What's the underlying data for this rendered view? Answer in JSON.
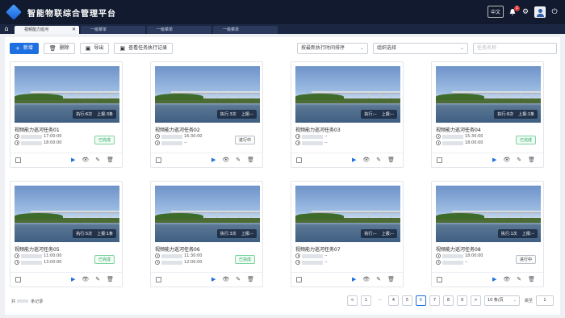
{
  "header": {
    "app_title": "智能物联综合管理平台",
    "lang": "中文",
    "notif_count": "1",
    "settings_icon": "gear-icon",
    "logout_icon": "logout-icon"
  },
  "tabs": [
    {
      "label": "视频能力巡河",
      "active": true
    },
    {
      "label": "一级菜单"
    },
    {
      "label": "一级菜单"
    },
    {
      "label": "一级菜单"
    }
  ],
  "toolbar": {
    "new_label": "新增",
    "delete_label": "删除",
    "export_label": "导出",
    "records_label": "查看任务执行记录"
  },
  "filters": {
    "sort": "按最新执行时间排序",
    "org": "组织选择",
    "search_placeholder": "任务名称"
  },
  "cards": [
    {
      "name": "视频能力巡河任务01",
      "time1": "17:00:00",
      "time2": "18:00:00",
      "status": "已完成",
      "status_type": "done",
      "exec_label": "执行:",
      "exec_value": "6次",
      "report_label": "上报:",
      "report_value": "3条"
    },
    {
      "name": "视频能力巡河任务02",
      "time1": "16:30:00",
      "time2": "--",
      "status": "进行中",
      "status_type": "running",
      "exec_label": "执行:",
      "exec_value": "3次",
      "report_label": "上报:",
      "report_value": "--"
    },
    {
      "name": "视频能力巡河任务03",
      "time1": "--",
      "time2": "--",
      "status": "",
      "status_type": "",
      "exec_label": "执行:",
      "exec_value": "--",
      "report_label": "上报:",
      "report_value": "--"
    },
    {
      "name": "视频能力巡河任务04",
      "time1": "15:30:00",
      "time2": "18:00:00",
      "status": "已完成",
      "status_type": "done",
      "exec_label": "执行:",
      "exec_value": "6次",
      "report_label": "上报:",
      "report_value": "1条"
    },
    {
      "name": "视频能力巡河任务05",
      "time1": "11:00:00",
      "time2": "13:00:00",
      "status": "已完成",
      "status_type": "done",
      "exec_label": "执行:",
      "exec_value": "5次",
      "report_label": "上报:",
      "report_value": "1条"
    },
    {
      "name": "视频能力巡河任务06",
      "time1": "11:30:00",
      "time2": "12:00:00",
      "status": "已完成",
      "status_type": "done",
      "exec_label": "执行:",
      "exec_value": "3次",
      "report_label": "上报:",
      "report_value": "--"
    },
    {
      "name": "视频能力巡河任务07",
      "time1": "--",
      "time2": "--",
      "status": "",
      "status_type": "",
      "exec_label": "执行:",
      "exec_value": "--",
      "report_label": "上报:",
      "report_value": "--"
    },
    {
      "name": "视频能力巡河任务08",
      "time1": "18:00:00",
      "time2": "--",
      "status": "进行中",
      "status_type": "running",
      "exec_label": "执行:",
      "exec_value": "1次",
      "report_label": "上报:",
      "report_value": "--"
    }
  ],
  "pagination": {
    "total_prefix": "共",
    "total_suffix": "条记录",
    "prev": "<",
    "next": ">",
    "pages": [
      "1",
      "...",
      "4",
      "5",
      "6",
      "7",
      "8",
      "9"
    ],
    "current": "6",
    "page_size": "10 条/页",
    "jump_label": "跳至",
    "jump_value": "1"
  }
}
